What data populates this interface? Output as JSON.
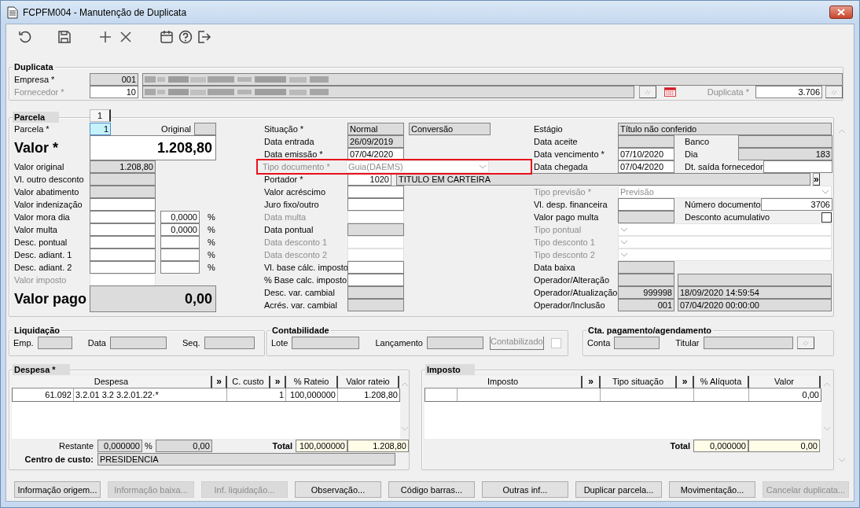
{
  "window": {
    "title": "FCPFM004 - Manutenção de Duplicata"
  },
  "toolbar": [
    {
      "kind": "refresh"
    },
    {
      "kind": "save"
    },
    {
      "kind": "add"
    },
    {
      "kind": "delete"
    },
    {
      "kind": "calendar"
    },
    {
      "kind": "help"
    },
    {
      "kind": "exit"
    }
  ],
  "duplicata": {
    "title": "Duplicata",
    "empresa": {
      "label": "Empresa *",
      "disabled": false,
      "code": "001",
      "code_readonly": true,
      "redacted": true
    },
    "fornecedor": {
      "label": "Fornecedor *",
      "disabled": true,
      "code": "10",
      "code_readonly": false,
      "redacted": true
    },
    "numero": {
      "label": "Duplicata *",
      "disabled": true,
      "value": "3.706"
    }
  },
  "parcela": {
    "title": "Parcela",
    "tab": "1",
    "left": [
      {
        "kind": "parcela",
        "label": "Parcela *",
        "value": "1",
        "focused": true,
        "original_label": "Original"
      },
      {
        "kind": "big",
        "label": "Valor *",
        "value": "1.208,80",
        "readonly": false,
        "disabled": false
      },
      {
        "kind": "field",
        "label": "Valor original",
        "value": "1.208,80",
        "readonly": true,
        "disabled": false
      },
      {
        "kind": "field",
        "label": "Vl. outro desconto",
        "readonly": true,
        "disabled": false
      },
      {
        "kind": "field",
        "label": "Valor abatimento",
        "readonly": true,
        "disabled": false
      },
      {
        "kind": "field",
        "label": "Valor indenização",
        "readonly": false,
        "disabled": false
      },
      {
        "kind": "pct",
        "label": "Valor mora dia",
        "readonly": false,
        "disabled": false,
        "pct": "0,0000",
        "unit": "%"
      },
      {
        "kind": "pct",
        "label": "Valor multa",
        "readonly": false,
        "disabled": false,
        "pct": "0,0000",
        "unit": "%"
      },
      {
        "kind": "pct",
        "label": "Desc. pontual",
        "readonly": false,
        "disabled": false,
        "unit": "%"
      },
      {
        "kind": "pct",
        "label": "Desc. adiant. 1",
        "readonly": false,
        "disabled": false,
        "unit": "%"
      },
      {
        "kind": "pct",
        "label": "Desc. adiant. 2",
        "readonly": false,
        "disabled": false,
        "unit": "%"
      },
      {
        "kind": "field",
        "label": "Valor imposto",
        "disabled": true
      },
      {
        "kind": "big",
        "label": "Valor pago",
        "value": "0,00",
        "readonly": true,
        "disabled": false
      }
    ],
    "middle": [
      {
        "kind": "pair",
        "label": "Situação *",
        "value": "Normal",
        "value2": "Conversão",
        "readonly": true,
        "disabled": false
      },
      {
        "kind": "field",
        "label": "Data entrada",
        "value": "26/09/2019",
        "readonly": true,
        "disabled": false
      },
      {
        "kind": "field",
        "label": "Data emissão *",
        "value": "07/04/2020",
        "readonly": false,
        "disabled": false
      },
      {
        "kind": "select",
        "label": "Tipo documento *",
        "value": "Guia(DAEMS)",
        "disabled": true,
        "highlighted": true
      },
      {
        "kind": "portador",
        "label": "Portador *",
        "code": "1020",
        "name": "TITULO EM CARTEIRA",
        "button": "»"
      },
      {
        "kind": "field",
        "label": "Valor acréscimo",
        "readonly": false,
        "disabled": false
      },
      {
        "kind": "field",
        "label": "Juro fixo/outro",
        "readonly": false,
        "disabled": false
      },
      {
        "kind": "field",
        "label": "Data multa",
        "disabled": true
      },
      {
        "kind": "field",
        "label": "Data pontual",
        "readonly": true,
        "disabled": false
      },
      {
        "kind": "field",
        "label": "Data desconto 1",
        "disabled": true
      },
      {
        "kind": "field",
        "label": "Data desconto 2",
        "disabled": true
      },
      {
        "kind": "field",
        "label": "Vl. base cálc. imposto",
        "readonly": false,
        "disabled": false
      },
      {
        "kind": "field",
        "label": "% Base calc. imposto",
        "readonly": false,
        "disabled": false
      },
      {
        "kind": "field",
        "label": "Desc. var. cambial",
        "readonly": true,
        "disabled": false
      },
      {
        "kind": "field",
        "label": "Acrés. var. cambial",
        "readonly": true,
        "disabled": false
      }
    ],
    "right": [
      {
        "kind": "wide",
        "label": "Estágio",
        "value": "Título não conferido",
        "readonly": true,
        "disabled": false
      },
      {
        "kind": "field",
        "label": "Data aceite",
        "readonly": true,
        "disabled": false,
        "side": {
          "kind": "field",
          "label": "Banco",
          "readonly": true
        }
      },
      {
        "kind": "field",
        "label": "Data vencimento *",
        "value": "07/10/2020",
        "readonly": false,
        "disabled": false,
        "side": {
          "kind": "field",
          "label": "Dia",
          "value": "183",
          "readonly": true
        }
      },
      {
        "kind": "field",
        "label": "Data chegada",
        "value": "07/04/2020",
        "readonly": false,
        "disabled": false,
        "side": {
          "kind": "field",
          "label": "Dt. saída fornecedor",
          "readonly": false
        }
      },
      {
        "kind": "select",
        "label": "Tipo previsão *",
        "value": "Previsão",
        "disabled": true,
        "highlighted": false
      },
      {
        "kind": "field",
        "label": "Vl. desp. financeira",
        "readonly": false,
        "disabled": false,
        "side": {
          "kind": "field",
          "label": "Número documento",
          "value": "3706",
          "readonly": false
        }
      },
      {
        "kind": "field",
        "label": "Valor pago multa",
        "readonly": true,
        "disabled": false,
        "side": {
          "kind": "checkbox",
          "label": "Desconto acumulativo",
          "checked": false
        }
      },
      {
        "kind": "select",
        "label": "Tipo pontual",
        "disabled": true,
        "highlighted": false
      },
      {
        "kind": "select",
        "label": "Tipo desconto 1",
        "disabled": true,
        "highlighted": false
      },
      {
        "kind": "select",
        "label": "Tipo desconto 2",
        "disabled": true,
        "highlighted": false
      },
      {
        "kind": "field",
        "label": "Data baixa",
        "readonly": true,
        "disabled": false
      },
      {
        "kind": "operator",
        "label": "Operador/Alteração"
      },
      {
        "kind": "operator",
        "label": "Operador/Atualização",
        "code": "999998",
        "date": "18/09/2020 14:59:54"
      },
      {
        "kind": "operator",
        "label": "Operador/Inclusão",
        "code": "001",
        "date": "07/04/2020 00:00:00"
      }
    ]
  },
  "liquidacao": {
    "title": "Liquidação",
    "fields": [
      {
        "label": "Emp."
      },
      {
        "label": "Data"
      },
      {
        "label": "Seq."
      }
    ]
  },
  "contabilidade": {
    "title": "Contabilidade",
    "fields": [
      {
        "label": "Lote"
      },
      {
        "label": "Lançamento"
      }
    ],
    "contabilizado": {
      "label": "Contabilizado",
      "disabled": true,
      "checked": false
    }
  },
  "cta_pagamento": {
    "title": "Cta. pagamento/agendamento",
    "fields": [
      {
        "label": "Conta"
      },
      {
        "label": "Titular"
      }
    ]
  },
  "despesa": {
    "title": "Despesa *",
    "columns": [
      "Despesa",
      "»",
      "C. custo",
      "»",
      "% Rateio",
      "Valor rateio"
    ],
    "rows": [
      {
        "code": "61.092",
        "description": "3.2.01 3.2 3.2.01.22·*",
        "cost_center": "1",
        "pct": "100,000000",
        "value": "1.208,80"
      }
    ],
    "restante_label": "Restante",
    "restante_pct": "0,000000",
    "pct_unit": "%",
    "restante_value": "0,00",
    "total_label": "Total",
    "total_pct": "100,000000",
    "total_value": "1.208,80",
    "centro_label": "Centro de custo:",
    "centro_value": "PRESIDENCIA"
  },
  "imposto": {
    "title": "Imposto",
    "columns": [
      "Imposto",
      "»",
      "Tipo situação",
      "»",
      "% Alíquota",
      "Valor"
    ],
    "rows": [
      {
        "value": "0,00"
      }
    ],
    "total_label": "Total",
    "total_pct": "0,000000",
    "total_value": "0,00"
  },
  "buttons": [
    {
      "label": "Informação origem...",
      "disabled": false
    },
    {
      "label": "Informação baixa...",
      "disabled": true
    },
    {
      "label": "Inf. liquidação...",
      "disabled": true
    },
    {
      "label": "Observação...",
      "disabled": false
    },
    {
      "label": "Código barras...",
      "disabled": false
    },
    {
      "label": "Outras inf...",
      "disabled": false
    },
    {
      "label": "Duplicar parcela...",
      "disabled": false
    },
    {
      "label": "Movimentação...",
      "disabled": false
    },
    {
      "label": "Cancelar duplicata...",
      "disabled": true
    }
  ]
}
